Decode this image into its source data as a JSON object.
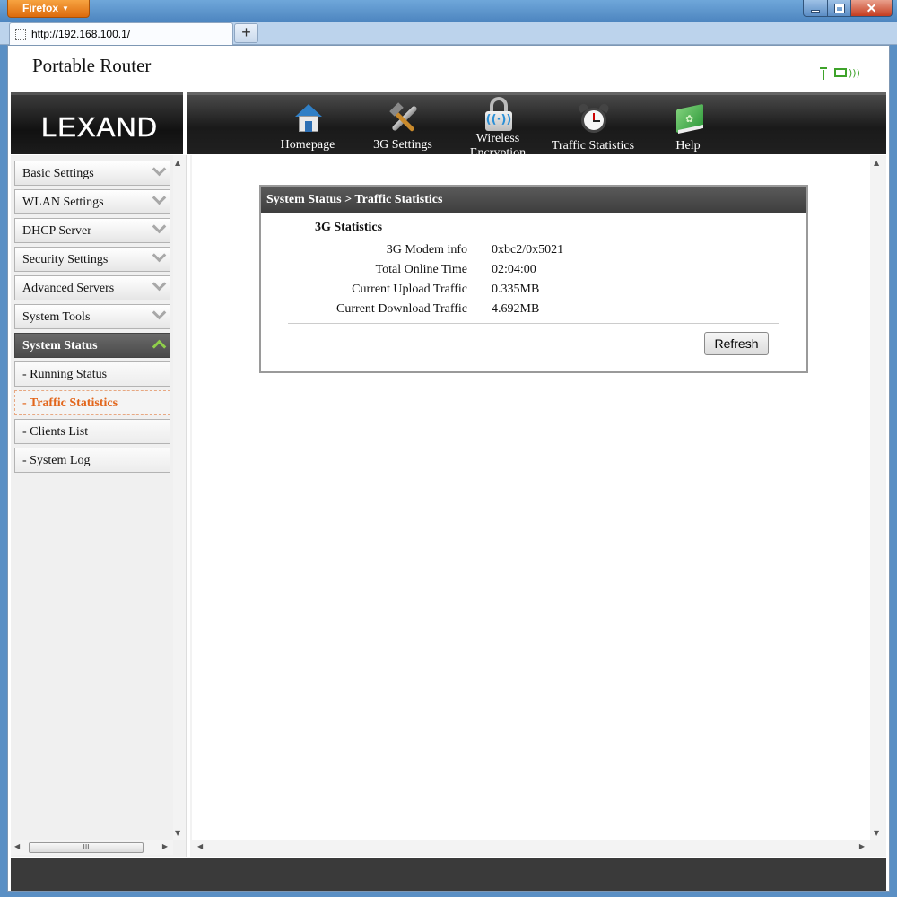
{
  "browser": {
    "app_button": "Firefox",
    "tab_url": "http://192.168.100.1/",
    "new_tab": "+",
    "close_symbol": "✕"
  },
  "site": {
    "title": "Portable Router",
    "logo": "LEXAND"
  },
  "nav": {
    "items": [
      {
        "label": "Homepage",
        "icon": "house-icon"
      },
      {
        "label": "3G Settings",
        "icon": "tools-icon"
      },
      {
        "label": "Wireless Encryption",
        "icon": "lock-wifi-icon"
      },
      {
        "label": "Traffic Statistics",
        "icon": "alarm-clock-icon"
      },
      {
        "label": "Help",
        "icon": "book-icon"
      }
    ]
  },
  "sidebar": {
    "items": [
      {
        "label": "Basic Settings"
      },
      {
        "label": "WLAN Settings"
      },
      {
        "label": "DHCP Server"
      },
      {
        "label": "Security Settings"
      },
      {
        "label": "Advanced Servers"
      },
      {
        "label": "System Tools"
      },
      {
        "label": "System Status"
      },
      {
        "label": "- Running Status"
      },
      {
        "label": "- Traffic Statistics"
      },
      {
        "label": "- Clients List"
      },
      {
        "label": "- System Log"
      }
    ],
    "scroll_thumb_grip": "III"
  },
  "panel": {
    "heading": "System Status > Traffic Statistics",
    "section_title": "3G Statistics",
    "rows": [
      {
        "key": "3G Modem info",
        "value": "0xbc2/0x5021"
      },
      {
        "key": "Total Online Time",
        "value": "02:04:00"
      },
      {
        "key": "Current Upload Traffic",
        "value": "0.335MB"
      },
      {
        "key": "Current Download Traffic",
        "value": "4.692MB"
      }
    ],
    "refresh_label": "Refresh"
  },
  "colors": {
    "accent_orange": "#e2661c",
    "status_green": "#3ea32a",
    "chrome_blue": "#5a8fc4"
  }
}
